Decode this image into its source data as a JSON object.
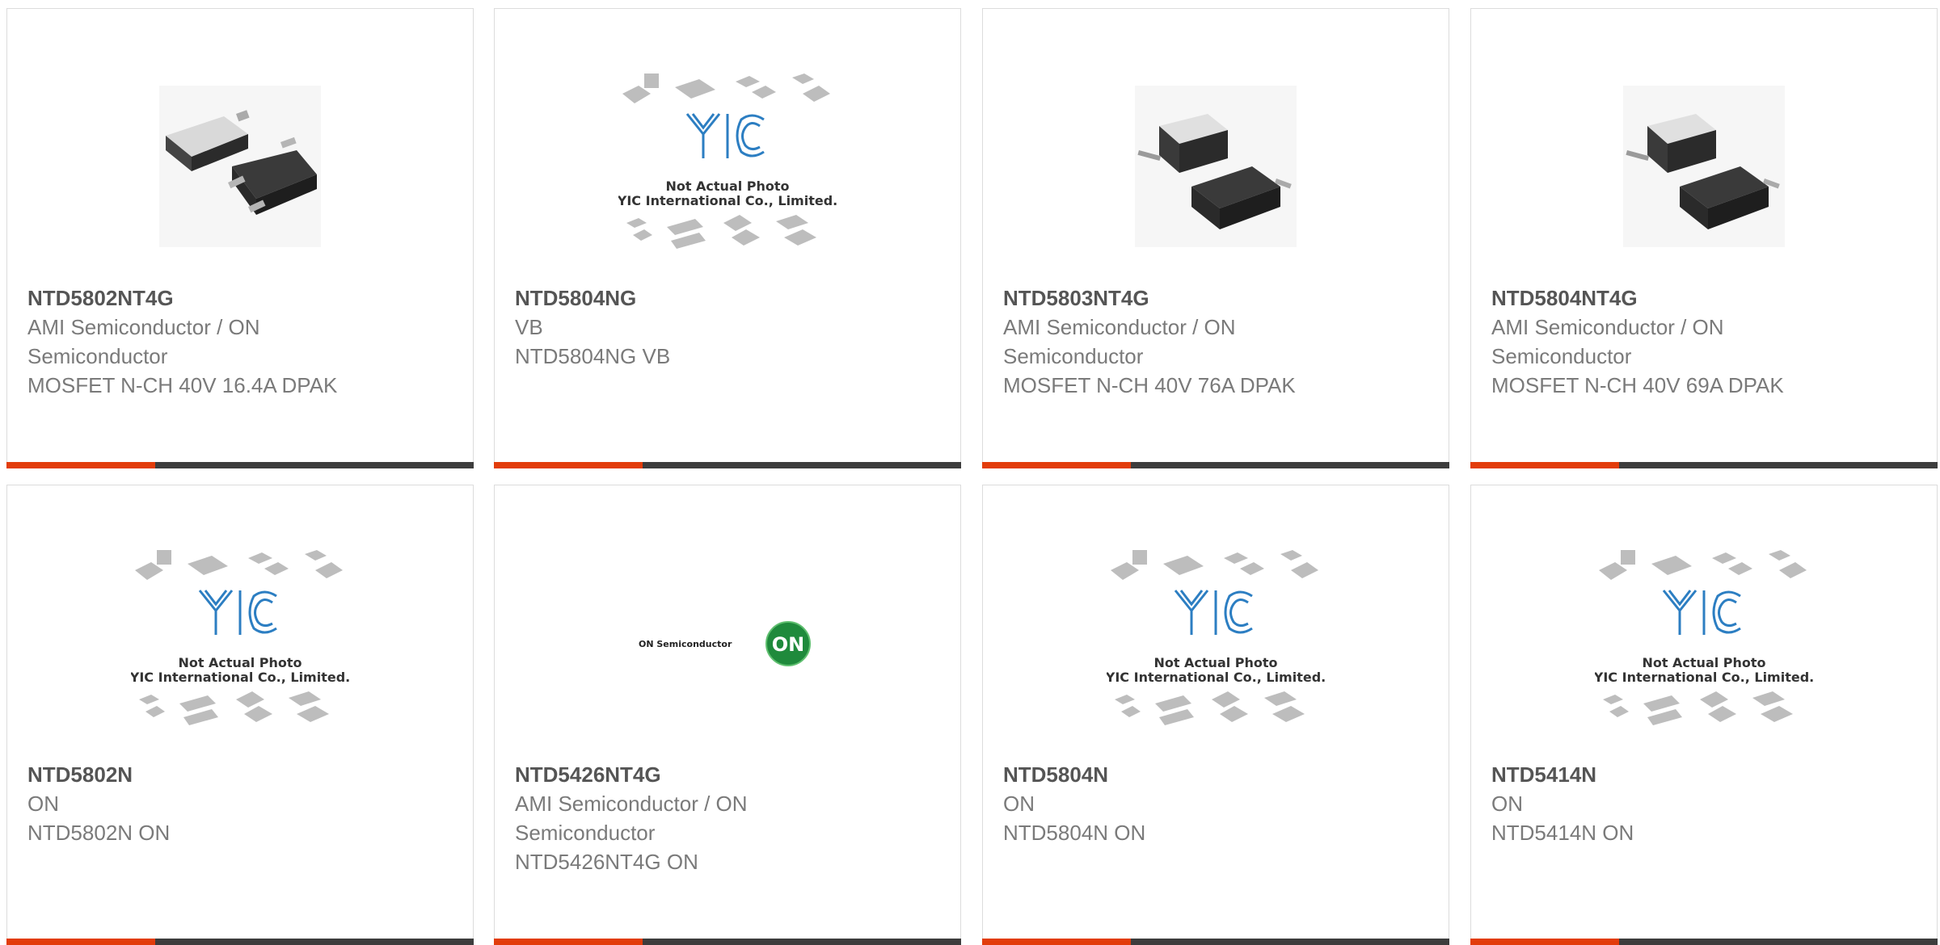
{
  "products": [
    {
      "part_number": "NTD5802NT4G",
      "manufacturer": "AMI Semiconductor / ON Semiconductor",
      "description": "MOSFET N-CH 40V 16.4A DPAK",
      "image": "dpak-photo-a"
    },
    {
      "part_number": "NTD5804NG",
      "manufacturer": "VB",
      "description": "NTD5804NG VB",
      "image": "yic-placeholder"
    },
    {
      "part_number": "NTD5803NT4G",
      "manufacturer": "AMI Semiconductor / ON Semiconductor",
      "description": "MOSFET N-CH 40V 76A DPAK",
      "image": "dpak-photo-b"
    },
    {
      "part_number": "NTD5804NT4G",
      "manufacturer": "AMI Semiconductor / ON Semiconductor",
      "description": "MOSFET N-CH 40V 69A DPAK",
      "image": "dpak-photo-b"
    },
    {
      "part_number": "NTD5802N",
      "manufacturer": "ON",
      "description": "NTD5802N ON",
      "image": "yic-placeholder"
    },
    {
      "part_number": "NTD5426NT4G",
      "manufacturer": "AMI Semiconductor / ON Semiconductor",
      "description": "NTD5426NT4G ON",
      "image": "on-semi-logo"
    },
    {
      "part_number": "NTD5804N",
      "manufacturer": "ON",
      "description": "NTD5804N ON",
      "image": "yic-placeholder"
    },
    {
      "part_number": "NTD5414N",
      "manufacturer": "ON",
      "description": "NTD5414N ON",
      "image": "yic-placeholder"
    }
  ],
  "placeholder": {
    "line1": "Not Actual Photo",
    "line2": "YIC International Co., Limited."
  },
  "logo": {
    "company": "ON Semiconductor",
    "badge": "ON"
  },
  "colors": {
    "accent": "#e23d0b",
    "bar": "#3d3d3d",
    "border": "#dcdcdc",
    "logo_green": "#1f8a3c"
  }
}
